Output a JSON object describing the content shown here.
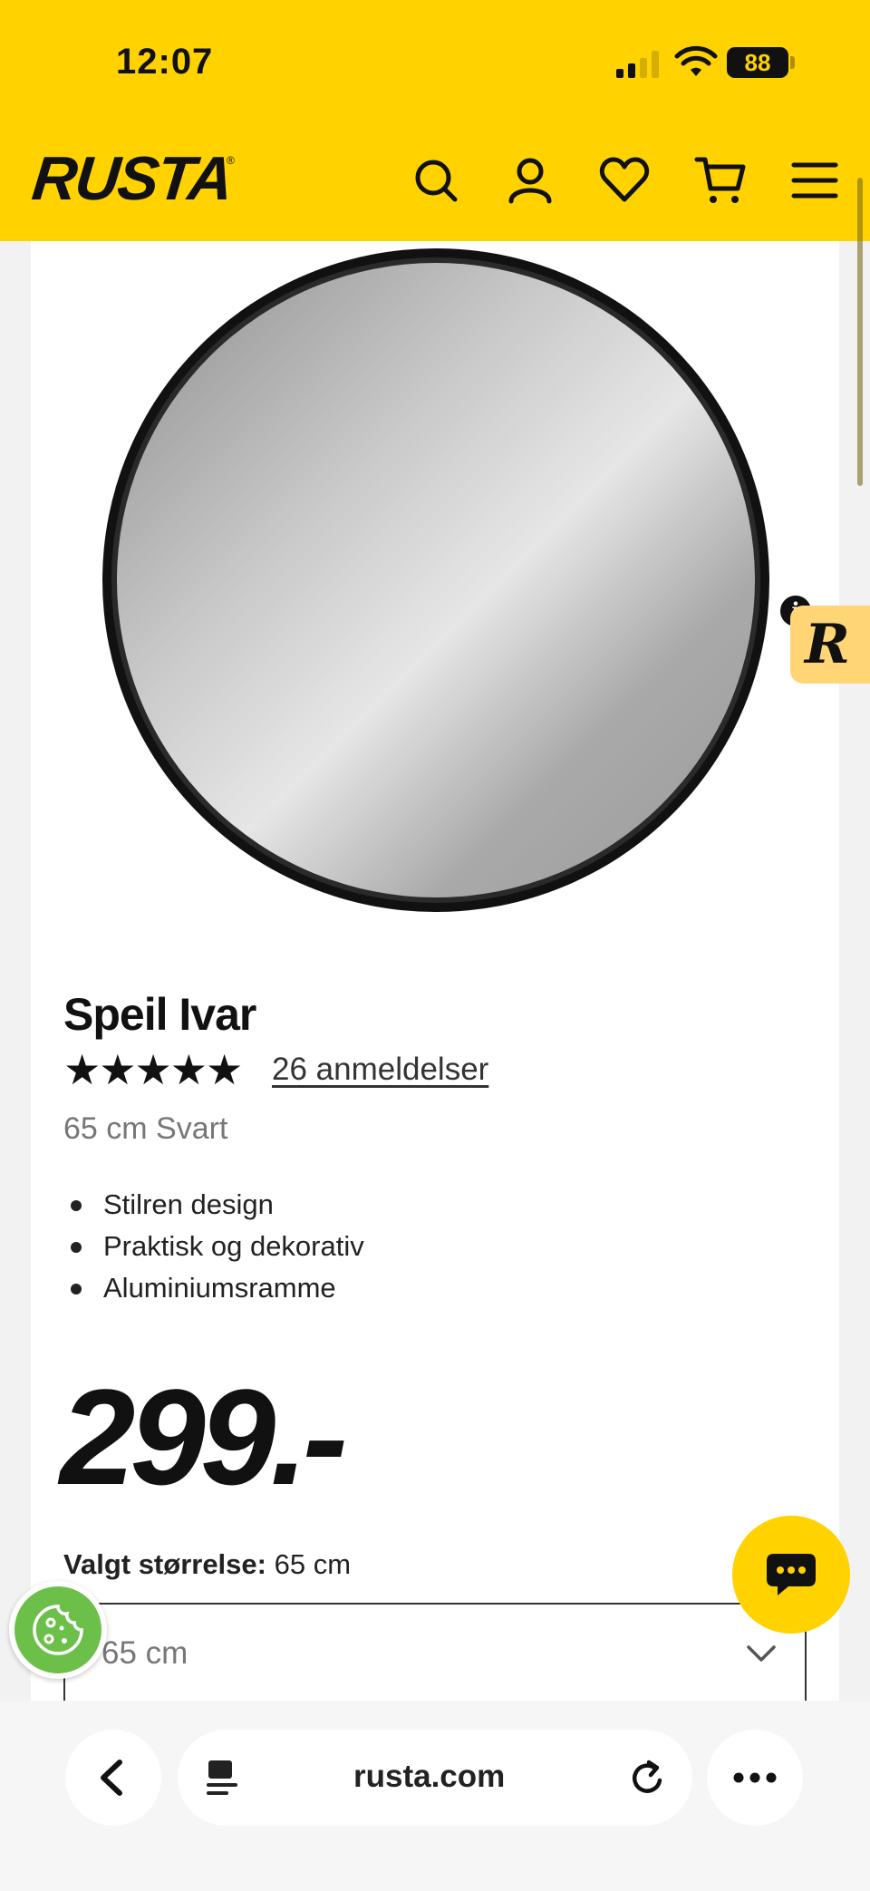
{
  "status_bar": {
    "time": "12:07",
    "battery": "88"
  },
  "header": {
    "logo": "RUSTA",
    "logo_mark": "®"
  },
  "product": {
    "title": "Speil Ivar",
    "stars": "★★★★★",
    "reviews": "26 anmeldelser",
    "variant": "65 cm Svart",
    "bullets": [
      "Stilren design",
      "Praktisk og dekorativ",
      "Aluminiumsramme"
    ],
    "price": "299.-",
    "size_label_bold": "Valgt størrelse:",
    "size_label_value": " 65 cm",
    "size_select_value": "65 cm"
  },
  "widget": {
    "letter": "R",
    "info": "i"
  },
  "browser": {
    "url": "rusta.com"
  },
  "colors": {
    "brand_yellow": "#ffd200",
    "cookie_green": "#6cc04a",
    "widget_peach": "#ffd575"
  },
  "icons": [
    "search-icon",
    "account-icon",
    "heart-icon",
    "cart-icon",
    "menu-icon",
    "chat-icon",
    "cookie-icon",
    "back-icon",
    "reader-icon",
    "reload-icon",
    "more-icon"
  ]
}
